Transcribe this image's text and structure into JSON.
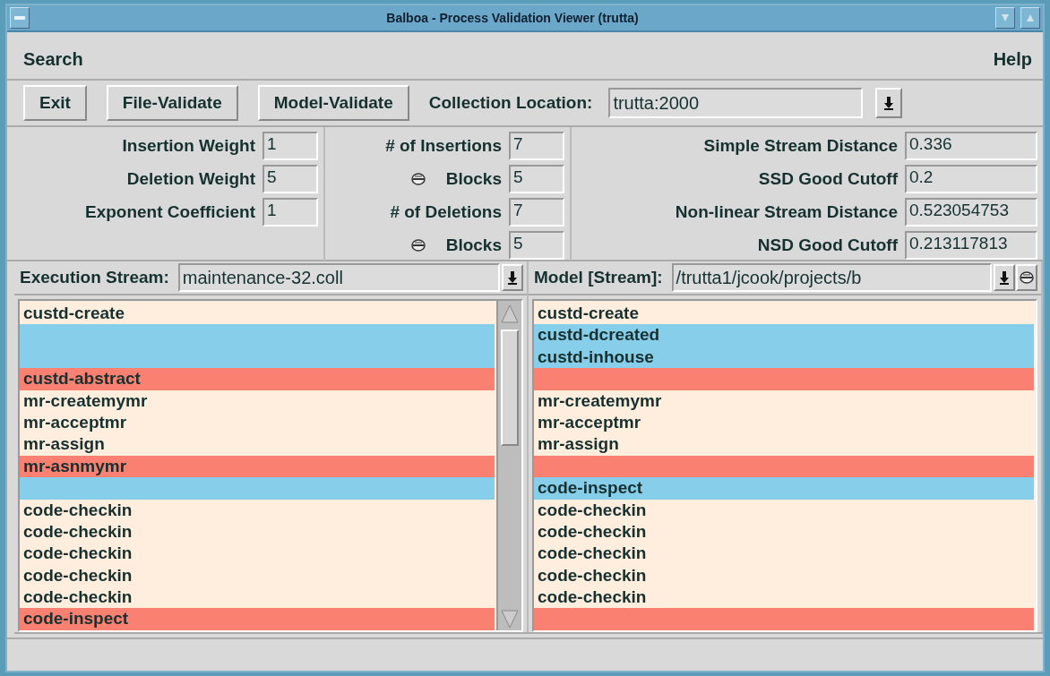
{
  "window": {
    "title": "Balboa - Process Validation Viewer (trutta)"
  },
  "menu": {
    "left": [
      "Search"
    ],
    "right": [
      "Help"
    ]
  },
  "toolbar": {
    "buttons": [
      "Exit",
      "File-Validate",
      "Model-Validate"
    ],
    "collection": {
      "label": "Collection Location:",
      "value": "trutta:2000"
    }
  },
  "params": [
    [
      {
        "kind": "plain",
        "label": "Insertion Weight",
        "value": "1"
      },
      {
        "kind": "plain",
        "label": "Deletion Weight",
        "value": "5"
      },
      {
        "kind": "plain",
        "label": "Exponent Coefficient",
        "value": "1"
      }
    ],
    [
      {
        "kind": "plain",
        "label": "# of Insertions",
        "value": "7"
      },
      {
        "kind": "toggle",
        "label": "Blocks",
        "value": "5"
      },
      {
        "kind": "plain",
        "label": "# of Deletions",
        "value": "7"
      },
      {
        "kind": "toggle",
        "label": "Blocks",
        "value": "5"
      }
    ],
    [
      {
        "kind": "plain",
        "label": "Simple Stream Distance",
        "value": "0.336"
      },
      {
        "kind": "plain",
        "label": "SSD Good Cutoff",
        "value": "0.2"
      },
      {
        "kind": "plain",
        "label": "Non-linear Stream Distance",
        "value": "0.523054753"
      },
      {
        "kind": "plain",
        "label": "NSD Good Cutoff",
        "value": "0.213117813"
      }
    ]
  ],
  "streams": [
    {
      "label": "Execution Stream:",
      "value": "maintenance-32.coll",
      "toggle": false,
      "scrollbar": true,
      "rows": [
        {
          "kind": "match",
          "text": "custd-create"
        },
        {
          "kind": "insert"
        },
        {
          "kind": "insert"
        },
        {
          "kind": "delete",
          "text": "custd-abstract"
        },
        {
          "kind": "match",
          "text": "mr-createmymr"
        },
        {
          "kind": "match",
          "text": "mr-acceptmr"
        },
        {
          "kind": "match",
          "text": "mr-assign"
        },
        {
          "kind": "delete",
          "text": "mr-asnmymr"
        },
        {
          "kind": "insert"
        },
        {
          "kind": "match",
          "text": "code-checkin"
        },
        {
          "kind": "match",
          "text": "code-checkin"
        },
        {
          "kind": "match",
          "text": "code-checkin"
        },
        {
          "kind": "match",
          "text": "code-checkin"
        },
        {
          "kind": "match",
          "text": "code-checkin"
        },
        {
          "kind": "delete",
          "text": "code-inspect"
        }
      ]
    },
    {
      "label": "Model [Stream]:",
      "value": "/trutta1/jcook/projects/b",
      "toggle": true,
      "scrollbar": false,
      "rows": [
        {
          "kind": "match",
          "text": "custd-create"
        },
        {
          "kind": "insert",
          "text": "custd-dcreated"
        },
        {
          "kind": "insert",
          "text": "custd-inhouse"
        },
        {
          "kind": "delete"
        },
        {
          "kind": "match",
          "text": "mr-createmymr"
        },
        {
          "kind": "match",
          "text": "mr-acceptmr"
        },
        {
          "kind": "match",
          "text": "mr-assign"
        },
        {
          "kind": "delete"
        },
        {
          "kind": "insert",
          "text": "code-inspect"
        },
        {
          "kind": "match",
          "text": "code-checkin"
        },
        {
          "kind": "match",
          "text": "code-checkin"
        },
        {
          "kind": "match",
          "text": "code-checkin"
        },
        {
          "kind": "match",
          "text": "code-checkin"
        },
        {
          "kind": "match",
          "text": "code-checkin"
        },
        {
          "kind": "delete"
        }
      ]
    }
  ]
}
